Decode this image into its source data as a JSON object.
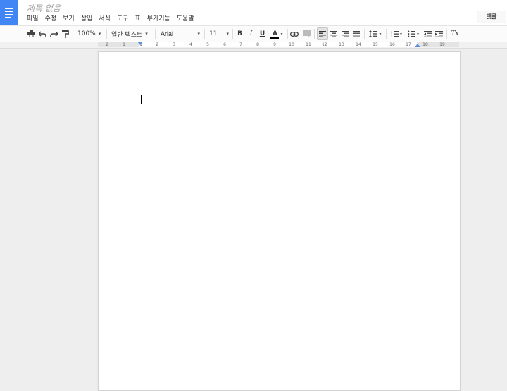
{
  "header": {
    "title": "제목 없음",
    "menu": [
      "파일",
      "수정",
      "보기",
      "삽입",
      "서식",
      "도구",
      "표",
      "부가기능",
      "도움말"
    ],
    "comment_label": "댓글"
  },
  "toolbar": {
    "zoom": "100%",
    "style": "일반 텍스트",
    "font": "Arial",
    "font_size": "11",
    "bold": "B",
    "italic": "I",
    "underline": "U",
    "text_color": "A",
    "clear_format": "Tx"
  },
  "ruler": {
    "labels": [
      "2",
      "1",
      "1",
      "2",
      "3",
      "4",
      "5",
      "6",
      "7",
      "8",
      "9",
      "10",
      "11",
      "12",
      "13",
      "14",
      "15",
      "16",
      "17",
      "18",
      "19"
    ]
  },
  "colors": {
    "brand": "#4285f4",
    "ruler_marker": "#5b8fd9",
    "text_color_bar": "#000000"
  },
  "icons": {
    "print": "print-icon",
    "undo": "undo-icon",
    "redo": "redo-icon",
    "paint_format": "paint-format-icon",
    "link": "link-icon",
    "comment": "comment-icon",
    "align_left": "align-left-icon",
    "align_center": "align-center-icon",
    "align_right": "align-right-icon",
    "justify": "align-justify-icon",
    "line_spacing": "line-spacing-icon",
    "numbered_list": "numbered-list-icon",
    "bulleted_list": "bulleted-list-icon",
    "decrease_indent": "decrease-indent-icon",
    "increase_indent": "increase-indent-icon"
  }
}
